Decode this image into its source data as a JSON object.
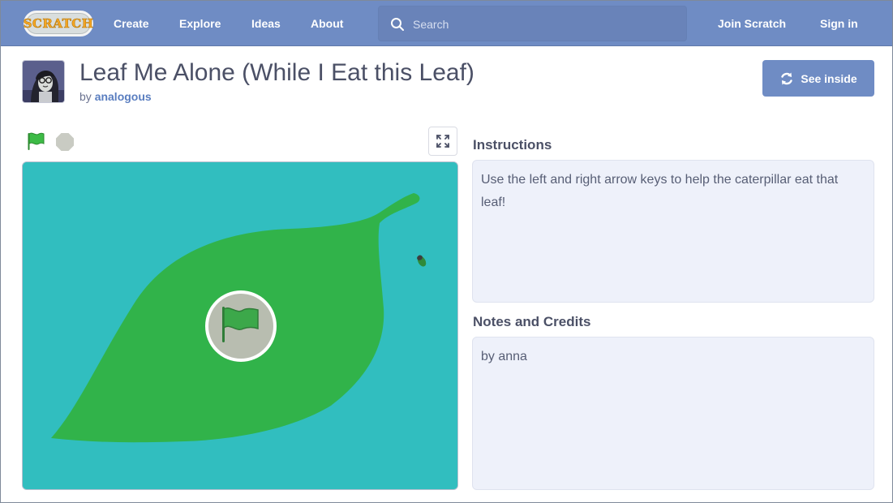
{
  "nav": {
    "logo_text": "SCRATCH",
    "create": "Create",
    "explore": "Explore",
    "ideas": "Ideas",
    "about": "About",
    "search_placeholder": "Search",
    "join": "Join Scratch",
    "signin": "Sign in"
  },
  "project": {
    "title": "Leaf Me Alone (While I Eat this Leaf)",
    "by_label": "by",
    "author": "analogous",
    "see_inside": "See inside"
  },
  "instructions": {
    "heading": "Instructions",
    "text": "Use the left and right arrow keys to help the caterpillar eat that leaf!"
  },
  "notes": {
    "heading": "Notes and Credits",
    "text": "by anna"
  },
  "colors": {
    "navbar": "#6f8cc4",
    "stage_bg": "#31bebf",
    "leaf": "#31b34a",
    "flag_green": "#34b13d"
  },
  "icons": {
    "search": "search-icon",
    "see_inside": "see-inside-icon",
    "green_flag": "green-flag-icon",
    "stop": "stop-icon",
    "fullscreen": "fullscreen-icon"
  }
}
